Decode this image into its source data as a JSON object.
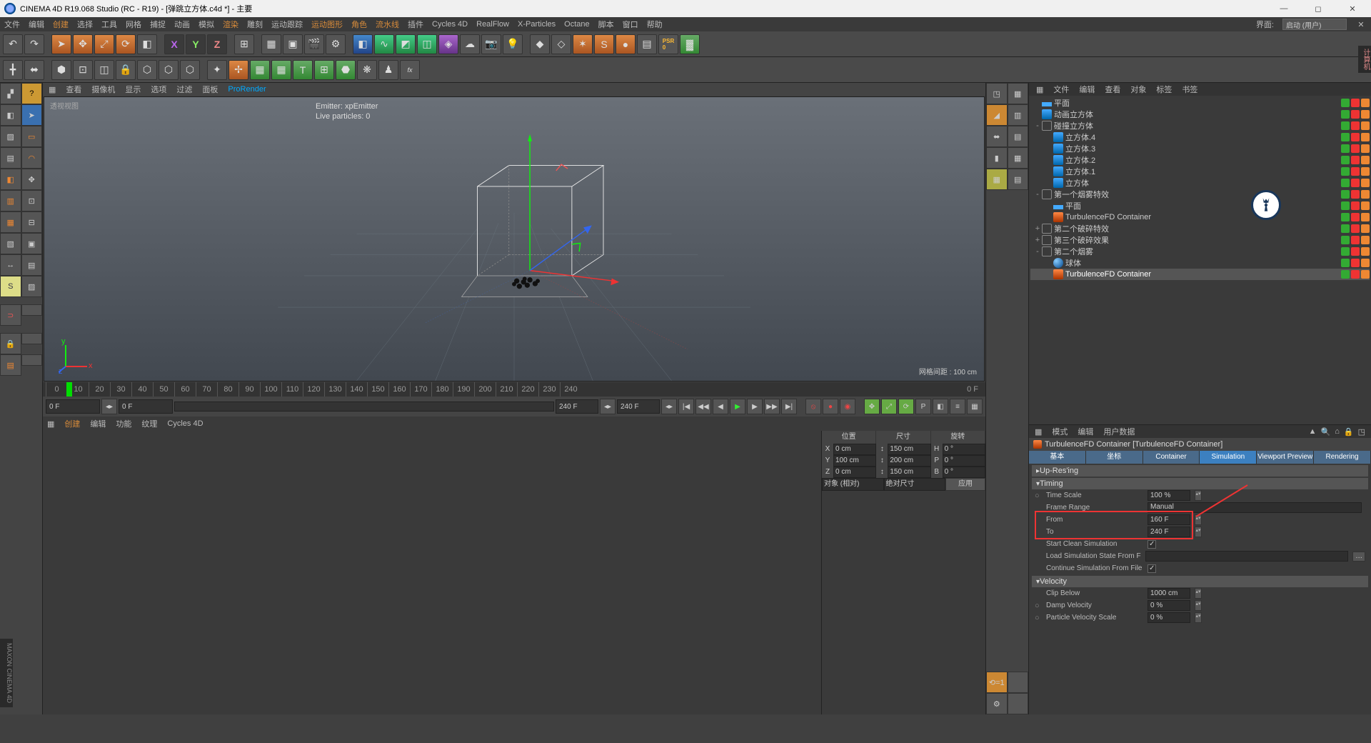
{
  "title": "CINEMA 4D R19.068 Studio (RC - R19) - [弹跳立方体.c4d *] - 主要",
  "menubar": [
    "文件",
    "编辑",
    "创建",
    "选择",
    "工具",
    "网格",
    "捕捉",
    "动画",
    "模拟",
    "渲染",
    "雕刻",
    "运动跟踪",
    "运动图形",
    "角色",
    "流水线",
    "插件",
    "Cycles 4D",
    "RealFlow",
    "X-Particles",
    "Octane",
    "脚本",
    "窗口",
    "帮助"
  ],
  "layout_label": "界面:",
  "layout_value": "启动 (用户)",
  "vp_menu": [
    "查看",
    "摄像机",
    "显示",
    "选项",
    "过滤",
    "面板",
    "ProRender"
  ],
  "vp_label": "透视视图",
  "vp_info_emitter": "Emitter: xpEmitter",
  "vp_info_particles": "Live particles: 0",
  "vp_gridinfo": "网格间距 : 100 cm",
  "ruler_ticks": [
    "0",
    "10",
    "20",
    "30",
    "40",
    "50",
    "60",
    "70",
    "80",
    "90",
    "100",
    "110",
    "120",
    "130",
    "140",
    "150",
    "160",
    "170",
    "180",
    "190",
    "200",
    "210",
    "220",
    "230",
    "240"
  ],
  "ruler_end": "0 F",
  "timeline": {
    "start": "0 F",
    "cur": "0 F",
    "mid1": "240 F",
    "mid2": "240 F"
  },
  "bottom_menu": [
    "创建",
    "编辑",
    "功能",
    "纹理",
    "Cycles 4D"
  ],
  "rp_tabs": [
    "文件",
    "编辑",
    "查看",
    "对象",
    "标签",
    "书签"
  ],
  "tree": [
    {
      "d": 0,
      "exp": "",
      "ic": "plane",
      "n": "平面"
    },
    {
      "d": 0,
      "exp": "",
      "ic": "cube",
      "n": "动画立方体"
    },
    {
      "d": 0,
      "exp": "-",
      "ic": "null",
      "n": "碰撞立方体"
    },
    {
      "d": 1,
      "exp": "",
      "ic": "cube",
      "n": "立方体.4"
    },
    {
      "d": 1,
      "exp": "",
      "ic": "cube",
      "n": "立方体.3"
    },
    {
      "d": 1,
      "exp": "",
      "ic": "cube",
      "n": "立方体.2"
    },
    {
      "d": 1,
      "exp": "",
      "ic": "cube",
      "n": "立方体.1"
    },
    {
      "d": 1,
      "exp": "",
      "ic": "cube",
      "n": "立方体"
    },
    {
      "d": 0,
      "exp": "-",
      "ic": "null",
      "n": "第一个烟雾特效"
    },
    {
      "d": 1,
      "exp": "",
      "ic": "plane",
      "n": "平面"
    },
    {
      "d": 1,
      "exp": "",
      "ic": "tfd",
      "n": "TurbulenceFD Container"
    },
    {
      "d": 0,
      "exp": "+",
      "ic": "null",
      "n": "第二个破碎特效"
    },
    {
      "d": 0,
      "exp": "+",
      "ic": "null",
      "n": "第三个破碎效果"
    },
    {
      "d": 0,
      "exp": "-",
      "ic": "null",
      "n": "第二个烟雾"
    },
    {
      "d": 1,
      "exp": "",
      "ic": "sphere",
      "n": "球体"
    },
    {
      "d": 1,
      "exp": "",
      "ic": "tfd",
      "n": "TurbulenceFD Container",
      "sel": true
    }
  ],
  "prop_header": [
    "模式",
    "编辑",
    "用户数据"
  ],
  "prop_title": "TurbulenceFD Container [TurbulenceFD Container]",
  "prop_tabs": [
    "基本",
    "坐标",
    "Container",
    "Simulation",
    "Viewport Preview",
    "Rendering"
  ],
  "prop_tab_sel": 3,
  "sections": {
    "upres": "Up-Res'ing",
    "timing": "Timing",
    "timescale_l": "Time Scale",
    "timescale_v": "100 %",
    "framerange_l": "Frame Range",
    "framerange_v": "Manual",
    "from_l": "From",
    "from_v": "160 F",
    "to_l": "To",
    "to_v": "240 F",
    "startclean_l": "Start Clean Simulation",
    "loadstate_l": "Load Simulation State From File",
    "contsim_l": "Continue Simulation From File",
    "velocity": "Velocity",
    "clipbelow_l": "Clip Below",
    "clipbelow_v": "1000 cm",
    "dampvel_l": "Damp Velocity",
    "dampvel_v": "0 %",
    "partvel_l": "Particle Velocity Scale",
    "partvel_v": "0 %"
  },
  "coord": {
    "heads": [
      "位置",
      "尺寸",
      "旋转"
    ],
    "rows": [
      {
        "a": "X",
        "p": "0 cm",
        "s": "150 cm",
        "rl": "H",
        "r": "0 °"
      },
      {
        "a": "Y",
        "p": "100 cm",
        "s": "200 cm",
        "rl": "P",
        "r": "0 °"
      },
      {
        "a": "Z",
        "p": "0 cm",
        "s": "150 cm",
        "rl": "B",
        "r": "0 °"
      }
    ],
    "foot_l": "对象 (相对)",
    "foot_m": "绝对尺寸",
    "foot_btn": "应用"
  },
  "side_tab": "计算机",
  "side_tab2": "MAXON CINEMA 4D"
}
